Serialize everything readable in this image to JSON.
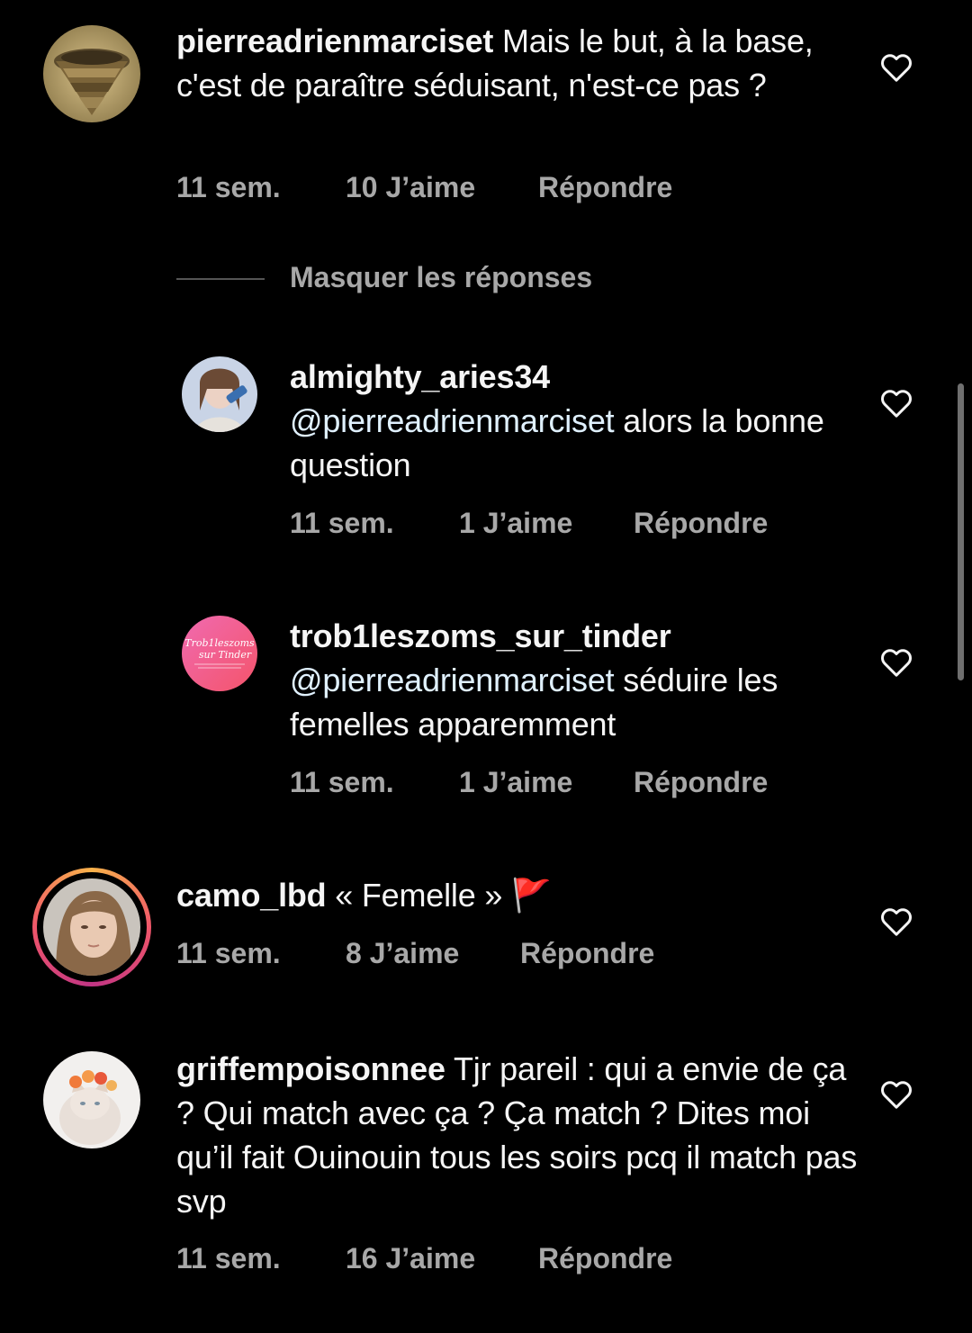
{
  "hide_replies_label": "Masquer les réponses",
  "comments": [
    {
      "username": "pierreadrienmarciset",
      "mention": "",
      "text": " Mais le but, à la base, c'est de paraître séduisant, n'est-ce pas ?",
      "time": "11 sem.",
      "likes": "10 J’aime",
      "reply": "Répondre"
    },
    {
      "username": "almighty_aries34",
      "mention": "@pierreadrienmarciset",
      "text": " alors la bonne question",
      "time": "11 sem.",
      "likes": "1 J’aime",
      "reply": "Répondre"
    },
    {
      "username": "trob1leszoms_sur_tinder",
      "mention": "@pierreadrienmarciset",
      "text": " séduire les femelles apparemment",
      "time": "11 sem.",
      "likes": "1 J’aime",
      "reply": "Répondre",
      "avatar_text": "Trob1leszoms sur Tinder"
    },
    {
      "username": "camo_lbd",
      "mention": "",
      "text": " « Femelle » 🚩",
      "time": "11 sem.",
      "likes": "8 J’aime",
      "reply": "Répondre"
    },
    {
      "username": "griffempoisonnee",
      "mention": "",
      "text": " Tjr pareil : qui a envie de ça ? Qui match avec ça ? Ça match ? Dites moi qu’il fait Ouinouin tous les soirs pcq il match pas svp",
      "time": "11 sem.",
      "likes": "16 J’aime",
      "reply": "Répondre"
    }
  ],
  "colors": {
    "background": "#000000",
    "text": "#f5f5f5",
    "meta": "#a8a8a8",
    "mention": "#e0f1ff"
  },
  "icons": {
    "like": "heart-outline-icon",
    "flag": "red-flag-emoji"
  }
}
